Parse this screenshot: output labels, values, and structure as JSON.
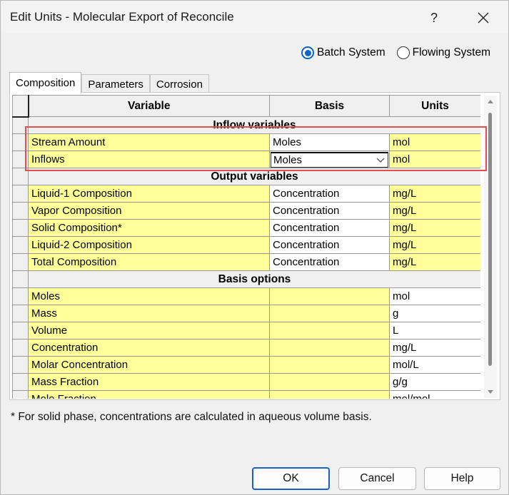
{
  "window": {
    "title": "Edit Units - Molecular Export of Reconcile",
    "help_glyph": "?",
    "close_icon": "close-icon"
  },
  "system": {
    "options": [
      {
        "label": "Batch System",
        "checked": true
      },
      {
        "label": "Flowing System",
        "checked": false
      }
    ]
  },
  "tabs": [
    {
      "label": "Composition",
      "active": true
    },
    {
      "label": "Parameters",
      "active": false
    },
    {
      "label": "Corrosion",
      "active": false
    }
  ],
  "grid": {
    "headers": {
      "variable": "Variable",
      "basis": "Basis",
      "units": "Units"
    },
    "sections": {
      "inflow": "Inflow variables",
      "output": "Output variables",
      "basis": "Basis options"
    },
    "inflow_rows": [
      {
        "variable": "Stream Amount",
        "basis": "Moles",
        "units": "mol"
      },
      {
        "variable": "Inflows",
        "basis": "Moles",
        "units": "mol"
      }
    ],
    "output_rows": [
      {
        "variable": "Liquid-1 Composition",
        "basis": "Concentration",
        "units": "mg/L"
      },
      {
        "variable": "Vapor Composition",
        "basis": "Concentration",
        "units": "mg/L"
      },
      {
        "variable": "Solid Composition*",
        "basis": "Concentration",
        "units": "mg/L"
      },
      {
        "variable": "Liquid-2 Composition",
        "basis": "Concentration",
        "units": "mg/L"
      },
      {
        "variable": "Total Composition",
        "basis": "Concentration",
        "units": "mg/L"
      }
    ],
    "basis_rows": [
      {
        "variable": "Moles",
        "basis": "",
        "units": "mol"
      },
      {
        "variable": "Mass",
        "basis": "",
        "units": "g"
      },
      {
        "variable": "Volume",
        "basis": "",
        "units": "L"
      },
      {
        "variable": "Concentration",
        "basis": "",
        "units": "mg/L"
      },
      {
        "variable": "Molar Concentration",
        "basis": "",
        "units": "mol/L"
      },
      {
        "variable": "Mass Fraction",
        "basis": "",
        "units": "g/g"
      },
      {
        "variable": "Mole Fraction",
        "basis": "",
        "units": "mol/mol"
      }
    ]
  },
  "footnote": "* For solid phase, concentrations are calculated in aqueous volume basis.",
  "buttons": {
    "ok": "OK",
    "cancel": "Cancel",
    "help": "Help"
  },
  "colors": {
    "accent": "#0b63c4",
    "cell_yellow": "#ffff99",
    "highlight": "#e05050"
  }
}
